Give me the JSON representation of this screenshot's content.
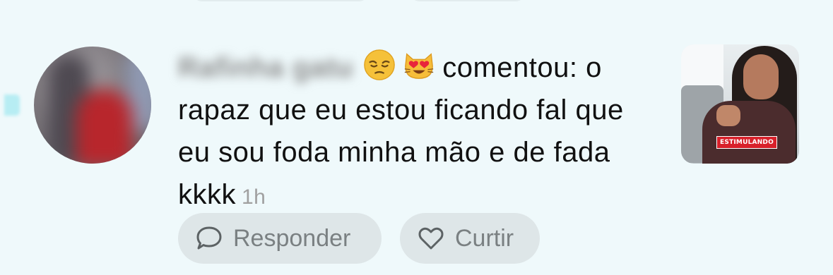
{
  "notification": {
    "username": "Rafinha gatu",
    "action": "comentou: o rapaz que eu estou ficando fal que eu sou foda minha mão e de fada kkkk",
    "timestamp": "1h",
    "emojis": [
      "pensive-face-emoji",
      "heart-eyes-cat-emoji"
    ]
  },
  "actions": {
    "reply_label": "Responder",
    "like_label": "Curtir"
  },
  "thumbnail": {
    "caption": "ESTIMULANDO"
  },
  "colors": {
    "background": "#eff9fb",
    "button_bg": "#dee6e8",
    "timestamp": "#a0a0a0",
    "thumbnail_label_bg": "#d8202a"
  }
}
